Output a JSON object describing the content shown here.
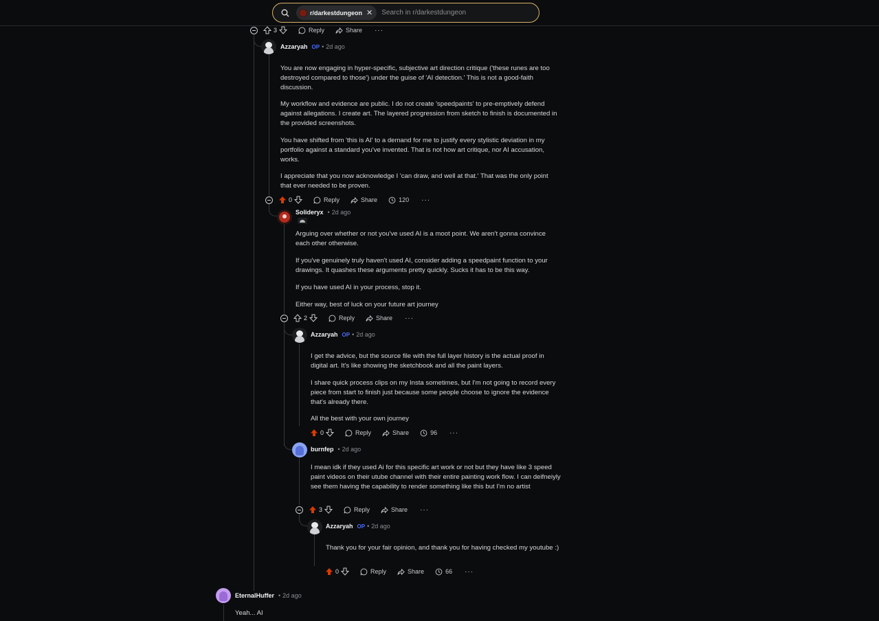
{
  "search": {
    "subreddit": "r/darkestdungeon",
    "placeholder": "Search in r/darkestdungeon"
  },
  "labels": {
    "reply": "Reply",
    "share": "Share",
    "more": "···",
    "op": "OP",
    "sep": "•"
  },
  "top_actions": {
    "votes": "3"
  },
  "comments": [
    {
      "author": "Azzaryah",
      "time": "2d ago",
      "paragraphs": [
        "You are now engaging in hyper-specific, subjective art direction critique ('these runes are too destroyed compared to those') under the guise of 'AI detection.' This is not a good-faith discussion.",
        "My workflow and evidence are public. I do not create 'speedpaints' to pre-emptively defend against allegations. I create art. The layered progression from sketch to finish is documented in the provided screenshots.",
        "You have shifted from 'this is AI' to a demand for me to justify every stylistic deviation in my portfolio against a standard you've invented. That is not how art critique, nor AI accusation, works.",
        "I appreciate that you now acknowledge I 'can draw, and well at that.' That was the only point that ever needed to be proven."
      ],
      "votes": "0",
      "awards": "120"
    },
    {
      "author": "Solideryx",
      "time": "2d ago",
      "paragraphs": [
        "Arguing over whether or not you've used AI is a moot point. We aren't gonna convince each other otherwise.",
        "If you've genuinely truly haven't used AI, consider adding a speedpaint function to your drawings. It quashes these arguments pretty quickly. Sucks it has to be this way.",
        "If you have used AI in your process, stop it.",
        "Either way, best of luck on your future art journey"
      ],
      "votes": "2"
    },
    {
      "author": "Azzaryah",
      "time": "2d ago",
      "paragraphs": [
        "I get the advice, but the source file with the full layer history is the actual proof in digital art. It's like showing the sketchbook and all the paint layers.",
        "I share quick process clips on my Insta sometimes, but I'm not going to record every piece from start to finish just because some people choose to ignore the evidence that's already there.",
        "All the best with your own journey"
      ],
      "votes": "0",
      "awards": "96"
    },
    {
      "author": "burnfep",
      "time": "2d ago",
      "paragraphs": [
        "I mean idk if they used Ai for this specific art work or not but they have like 3 speed paint videos on their utube channel with their entire painting work flow. I can deifneiyly see them having the capability to render something like this but I'm no artist"
      ],
      "votes": "3"
    },
    {
      "author": "Azzaryah",
      "time": "2d ago",
      "paragraphs": [
        "Thank you for your fair opinion, and thank you for having checked my youtube :)"
      ],
      "votes": "0",
      "awards": "66"
    },
    {
      "author": "EternalHuffer",
      "time": "2d ago",
      "paragraphs": [
        "Yeah... AI"
      ]
    }
  ],
  "colors": {
    "accent_upvote": "#d93a00",
    "op_badge": "#4a6cf7",
    "search_border": "#d7b46a",
    "background": "#0b0c0e"
  }
}
